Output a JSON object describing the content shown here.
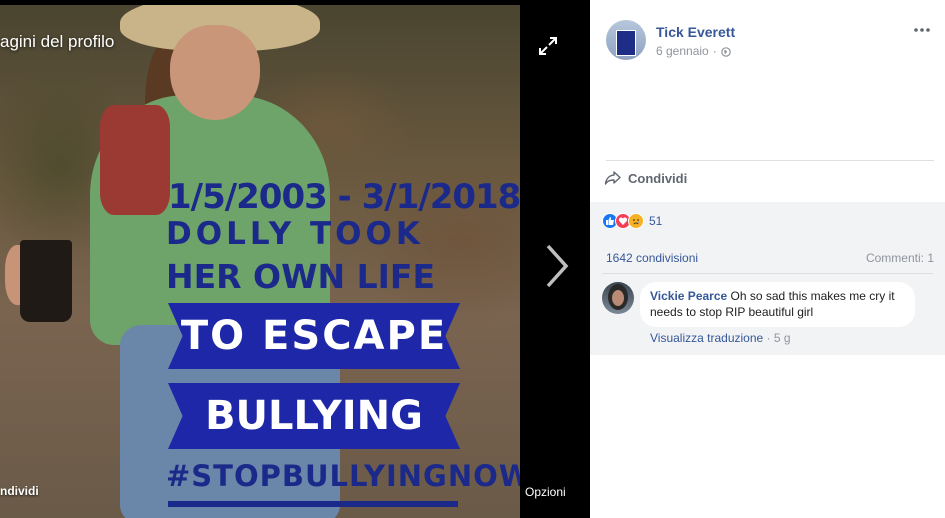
{
  "viewer": {
    "title": "agini del profilo",
    "share_label": "ndividi",
    "options_label": "Opzioni",
    "photo_text": {
      "dates": "1/5/2003 - 3/1/2018",
      "line1": "DOLLY TOOK",
      "line2": "HER OWN LIFE",
      "banner1": "TO ESCAPE",
      "banner2": "BULLYING",
      "hashtag": "#STOPBULLYINGNOW"
    },
    "colors": {
      "photo_text": "#1b2a8a",
      "banner": "#1e27a8"
    }
  },
  "post": {
    "author": "Tick Everett",
    "date": "6 gennaio",
    "share_label": "Condividi",
    "reactions": {
      "types": [
        "like-icon",
        "love-icon",
        "sad-icon"
      ],
      "count": "51"
    },
    "shares": "1642 condivisioni",
    "comments": "Commenti: 1",
    "colors": {
      "link": "#365899",
      "muted": "#90949c"
    }
  },
  "comment": {
    "author": "Vickie Pearce",
    "text": "Oh so sad this makes me cry it needs to stop RIP beautiful girl",
    "translate": "Visualizza traduzione",
    "age": "5 g"
  }
}
